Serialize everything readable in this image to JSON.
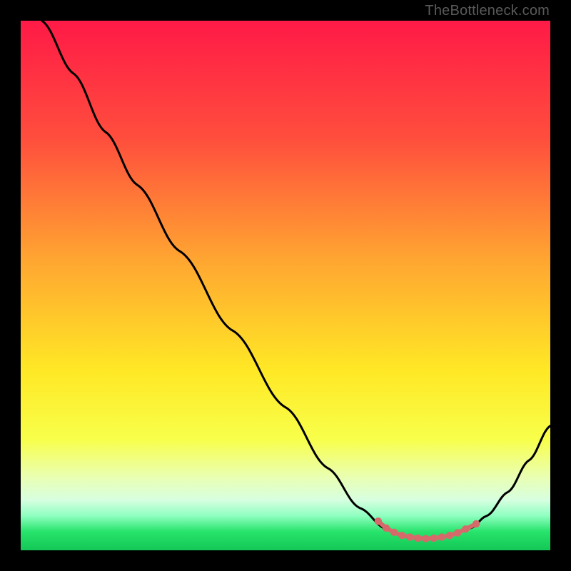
{
  "watermark": "TheBottleneck.com",
  "chart_data": {
    "type": "line",
    "title": "",
    "xlabel": "",
    "ylabel": "",
    "xlim": [
      0,
      100
    ],
    "ylim": [
      0,
      100
    ],
    "gradient_stops": [
      {
        "pos": 0,
        "color": "#ff1a47"
      },
      {
        "pos": 0.22,
        "color": "#ff4d3d"
      },
      {
        "pos": 0.45,
        "color": "#ffa531"
      },
      {
        "pos": 0.66,
        "color": "#ffe825"
      },
      {
        "pos": 0.79,
        "color": "#f8ff4a"
      },
      {
        "pos": 0.86,
        "color": "#eaffb0"
      },
      {
        "pos": 0.905,
        "color": "#d7ffe0"
      },
      {
        "pos": 0.935,
        "color": "#8effc0"
      },
      {
        "pos": 0.965,
        "color": "#27e36b"
      },
      {
        "pos": 1,
        "color": "#14c756"
      }
    ],
    "series": [
      {
        "name": "curve",
        "color": "#000000",
        "points": [
          {
            "x": 4.0,
            "y": 100.0
          },
          {
            "x": 10.0,
            "y": 90.0
          },
          {
            "x": 16.0,
            "y": 79.0
          },
          {
            "x": 22.0,
            "y": 69.0
          },
          {
            "x": 30.0,
            "y": 56.5
          },
          {
            "x": 40.0,
            "y": 41.5
          },
          {
            "x": 50.0,
            "y": 27.0
          },
          {
            "x": 58.0,
            "y": 15.5
          },
          {
            "x": 64.0,
            "y": 8.0
          },
          {
            "x": 69.0,
            "y": 4.0
          },
          {
            "x": 73.0,
            "y": 2.5
          },
          {
            "x": 77.0,
            "y": 2.2
          },
          {
            "x": 81.0,
            "y": 2.8
          },
          {
            "x": 85.0,
            "y": 4.2
          },
          {
            "x": 88.0,
            "y": 6.5
          },
          {
            "x": 92.0,
            "y": 11.0
          },
          {
            "x": 96.0,
            "y": 17.0
          },
          {
            "x": 100.0,
            "y": 23.5
          }
        ]
      },
      {
        "name": "highlight-dots",
        "color": "#d66a6a",
        "points": [
          {
            "x": 67.5,
            "y": 5.5
          },
          {
            "x": 69.0,
            "y": 4.2
          },
          {
            "x": 70.5,
            "y": 3.4
          },
          {
            "x": 72.0,
            "y": 2.8
          },
          {
            "x": 73.5,
            "y": 2.5
          },
          {
            "x": 75.0,
            "y": 2.3
          },
          {
            "x": 76.5,
            "y": 2.2
          },
          {
            "x": 78.0,
            "y": 2.3
          },
          {
            "x": 79.5,
            "y": 2.5
          },
          {
            "x": 81.0,
            "y": 2.8
          },
          {
            "x": 82.5,
            "y": 3.3
          },
          {
            "x": 84.0,
            "y": 4.0
          },
          {
            "x": 86.0,
            "y": 5.0
          }
        ]
      }
    ]
  }
}
